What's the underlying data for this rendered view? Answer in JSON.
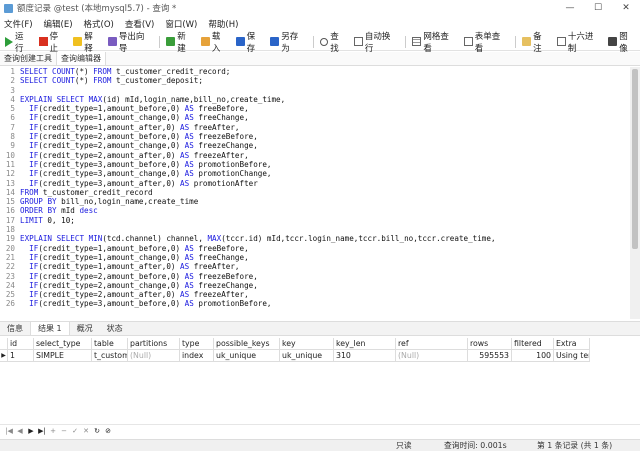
{
  "window": {
    "title": "额度记录 @test (本地mysql5.7) - 查询 *",
    "controls": [
      "—",
      "☐",
      "✕"
    ]
  },
  "menu": [
    "文件(F)",
    "编辑(E)",
    "格式(O)",
    "查看(V)",
    "窗口(W)",
    "帮助(H)"
  ],
  "toolbar": {
    "run": "运行",
    "stop": "停止",
    "explain": "解释",
    "export_wizard": "导出向导",
    "new": "新建",
    "load": "载入",
    "save": "保存",
    "save_as": "另存为",
    "find": "查找",
    "wrap": "自动换行",
    "grid_view": "网格查看",
    "form_view": "表单查看",
    "memo": "备注",
    "hex": "十六进制",
    "image": "图像",
    "colors": {
      "run": "#2e9e3a",
      "stop": "#d9301f",
      "explain": "#f0c020",
      "export": "#7a5cc0",
      "new": "#3a9d3a",
      "load": "#e6a23a",
      "save": "#2a64c8",
      "save_as": "#2a64c8"
    }
  },
  "editor_tabs": [
    "查询创建工具",
    "查询编辑器"
  ],
  "code_lines": [
    {
      "n": "1",
      "text": "SELECT COUNT(*) FROM t_customer_credit_record;"
    },
    {
      "n": "2",
      "text": "SELECT COUNT(*) FROM t_customer_deposit;"
    },
    {
      "n": "3",
      "text": ""
    },
    {
      "n": "4",
      "text": "EXPLAIN SELECT MAX(id) mId,login_name,bill_no,create_time,"
    },
    {
      "n": "5",
      "text": "  IF(credit_type=1,amount_before,0) AS freeBefore,"
    },
    {
      "n": "6",
      "text": "  IF(credit_type=1,amount_change,0) AS freeChange,"
    },
    {
      "n": "7",
      "text": "  IF(credit_type=1,amount_after,0) AS freeAfter,"
    },
    {
      "n": "8",
      "text": "  IF(credit_type=2,amount_before,0) AS freezeBefore,"
    },
    {
      "n": "9",
      "text": "  IF(credit_type=2,amount_change,0) AS freezeChange,"
    },
    {
      "n": "10",
      "text": "  IF(credit_type=2,amount_after,0) AS freezeAfter,"
    },
    {
      "n": "11",
      "text": "  IF(credit_type=3,amount_before,0) AS promotionBefore,"
    },
    {
      "n": "12",
      "text": "  IF(credit_type=3,amount_change,0) AS promotionChange,"
    },
    {
      "n": "13",
      "text": "  IF(credit_type=3,amount_after,0) AS promotionAfter"
    },
    {
      "n": "14",
      "text": "FROM t_customer_credit_record"
    },
    {
      "n": "15",
      "text": "GROUP BY bill_no,login_name,create_time"
    },
    {
      "n": "16",
      "text": "ORDER BY mId desc"
    },
    {
      "n": "17",
      "text": "LIMIT 0, 10;"
    },
    {
      "n": "18",
      "text": ""
    },
    {
      "n": "19",
      "text": "EXPLAIN SELECT MIN(tcd.channel) channel, MAX(tccr.id) mId,tccr.login_name,tccr.bill_no,tccr.create_time,"
    },
    {
      "n": "20",
      "text": "  IF(credit_type=1,amount_before,0) AS freeBefore,"
    },
    {
      "n": "21",
      "text": "  IF(credit_type=1,amount_change,0) AS freeChange,"
    },
    {
      "n": "22",
      "text": "  IF(credit_type=1,amount_after,0) AS freeAfter,"
    },
    {
      "n": "23",
      "text": "  IF(credit_type=2,amount_before,0) AS freezeBefore,"
    },
    {
      "n": "24",
      "text": "  IF(credit_type=2,amount_change,0) AS freezeChange,"
    },
    {
      "n": "25",
      "text": "  IF(credit_type=2,amount_after,0) AS freezeAfter,"
    },
    {
      "n": "26",
      "text": "  IF(credit_type=3,amount_before,0) AS promotionBefore,"
    }
  ],
  "result_tabs": [
    "信息",
    "结果 1",
    "概况",
    "状态"
  ],
  "grid": {
    "columns": [
      "id",
      "select_type",
      "table",
      "partitions",
      "type",
      "possible_keys",
      "key",
      "key_len",
      "ref",
      "rows",
      "filtered",
      "Extra"
    ],
    "rows": [
      [
        "1",
        "SIMPLE",
        "t_custome",
        "(Null)",
        "index",
        "uk_unique",
        "uk_unique",
        "310",
        "(Null)",
        "595553",
        "100",
        "Using ten"
      ]
    ]
  },
  "nav_buttons": [
    "|◀",
    "◀",
    "▶",
    "▶|",
    "+",
    "−",
    "✓",
    "✕",
    "↻",
    "⊘"
  ],
  "status": {
    "mode": "只读",
    "query_time": "查询时间: 0.001s",
    "record": "第 1 条记录 (共 1 条)"
  }
}
